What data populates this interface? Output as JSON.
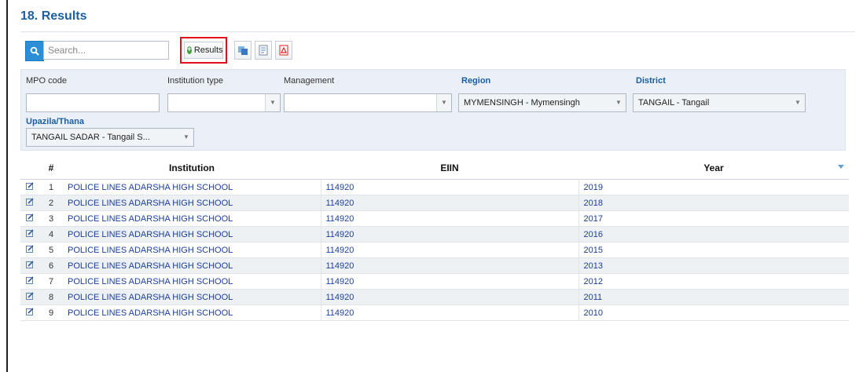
{
  "page": {
    "title": "18. Results"
  },
  "toolbar": {
    "search_placeholder": "Search...",
    "result_button_label": "Results"
  },
  "filters": {
    "mpo_code_label": "MPO code",
    "institution_type_label": "Institution type",
    "management_label": "Management",
    "region_label": "Region",
    "region_value": "MYMENSINGH - Mymensingh",
    "district_label": "District",
    "district_value": "TANGAIL - Tangail",
    "upazila_label": "Upazila/Thana",
    "upazila_value": "TANGAIL SADAR - Tangail S..."
  },
  "table": {
    "columns": [
      "#",
      "Institution",
      "EIIN",
      "Year"
    ],
    "rows": [
      {
        "num": "1",
        "institution": "POLICE LINES ADARSHA HIGH SCHOOL",
        "eiin": "114920",
        "year": "2019"
      },
      {
        "num": "2",
        "institution": "POLICE LINES ADARSHA HIGH SCHOOL",
        "eiin": "114920",
        "year": "2018"
      },
      {
        "num": "3",
        "institution": "POLICE LINES ADARSHA HIGH SCHOOL",
        "eiin": "114920",
        "year": "2017"
      },
      {
        "num": "4",
        "institution": "POLICE LINES ADARSHA HIGH SCHOOL",
        "eiin": "114920",
        "year": "2016"
      },
      {
        "num": "5",
        "institution": "POLICE LINES ADARSHA HIGH SCHOOL",
        "eiin": "114920",
        "year": "2015"
      },
      {
        "num": "6",
        "institution": "POLICE LINES ADARSHA HIGH SCHOOL",
        "eiin": "114920",
        "year": "2013"
      },
      {
        "num": "7",
        "institution": "POLICE LINES ADARSHA HIGH SCHOOL",
        "eiin": "114920",
        "year": "2012"
      },
      {
        "num": "8",
        "institution": "POLICE LINES ADARSHA HIGH SCHOOL",
        "eiin": "114920",
        "year": "2011"
      },
      {
        "num": "9",
        "institution": "POLICE LINES ADARSHA HIGH SCHOOL",
        "eiin": "114920",
        "year": "2010"
      }
    ]
  },
  "colors": {
    "accent": "#2b8fd8",
    "title": "#1a5fa3",
    "highlight": "#e3101b",
    "link": "#1a3e9b"
  }
}
